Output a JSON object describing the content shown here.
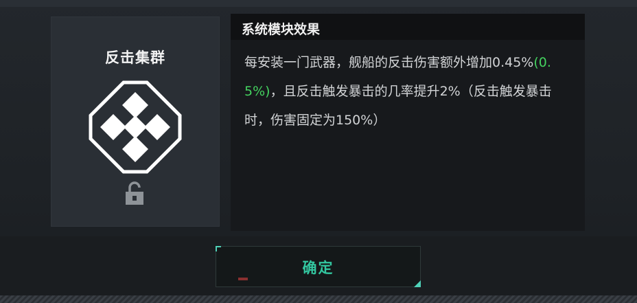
{
  "module": {
    "name": "反击集群",
    "icon": "cross-diamond-emblem-icon",
    "lock_icon": "padlock-icon"
  },
  "effect": {
    "title": "系统模块效果",
    "desc_before": "每安装一门武器，舰船的反击伤害额外增加0.45%",
    "desc_highlight": "(0.5%)",
    "desc_after": "，且反击触发暴击的几率提升2%（反击触发暴击时，伤害固定为150%）"
  },
  "buttons": {
    "confirm_label": "确定"
  },
  "colors": {
    "highlight": "#44d25f",
    "accent": "#33c7a0"
  }
}
